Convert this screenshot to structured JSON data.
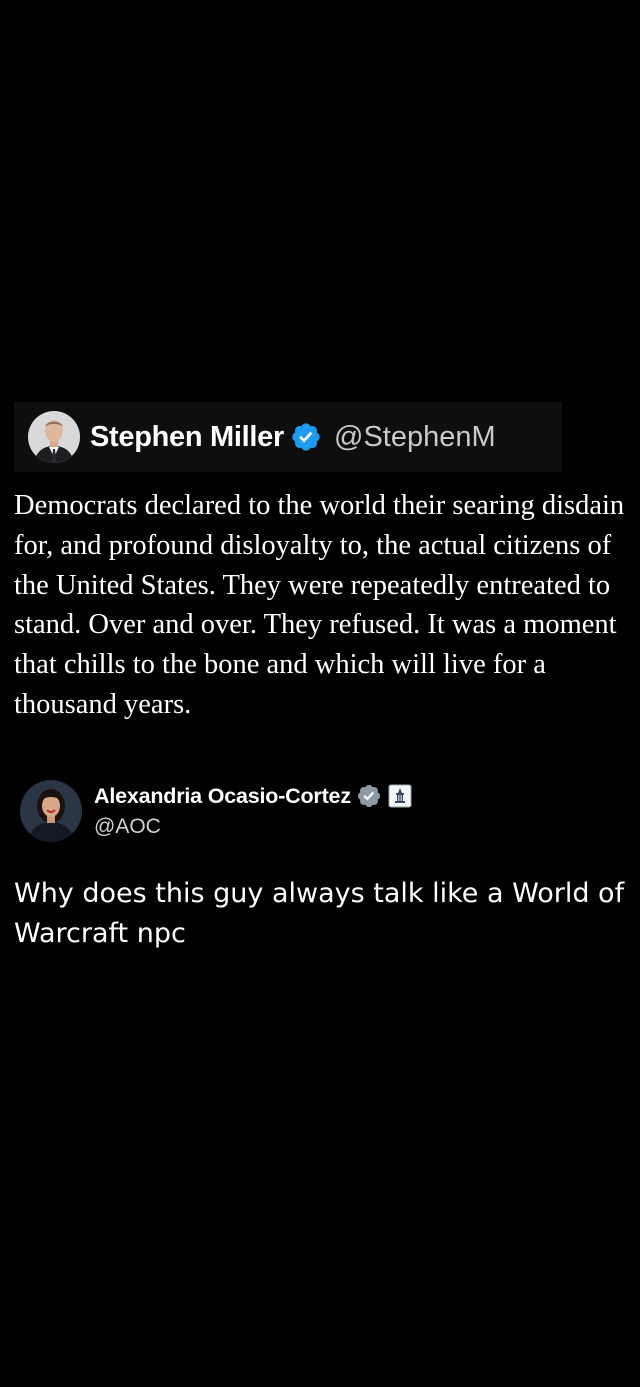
{
  "post": {
    "author_name": "Stephen Miller",
    "author_handle": "@StephenM",
    "verified_icon": "verified-badge-icon",
    "text": "Democrats declared to the world their searing disdain for, and profound disloyalty to, the actual citizens of the United States. They were repeatedly entreated to stand. Over and over. They refused. It was a moment that chills to the bone and which will live for a thousand years."
  },
  "reply": {
    "author_name": "Alexandria Ocasio-Cortez",
    "author_handle": "@AOC",
    "verified_icon": "verified-badge-icon",
    "affiliation_icon": "government-affiliation-icon",
    "text": "Why does this guy always talk like a World of Warcraft npc"
  },
  "colors": {
    "background": "#000000",
    "header_strip": "#0e0e0e",
    "verified_blue": "#1d9bf0",
    "text": "#ffffff",
    "handle": "#c9c9c9"
  }
}
